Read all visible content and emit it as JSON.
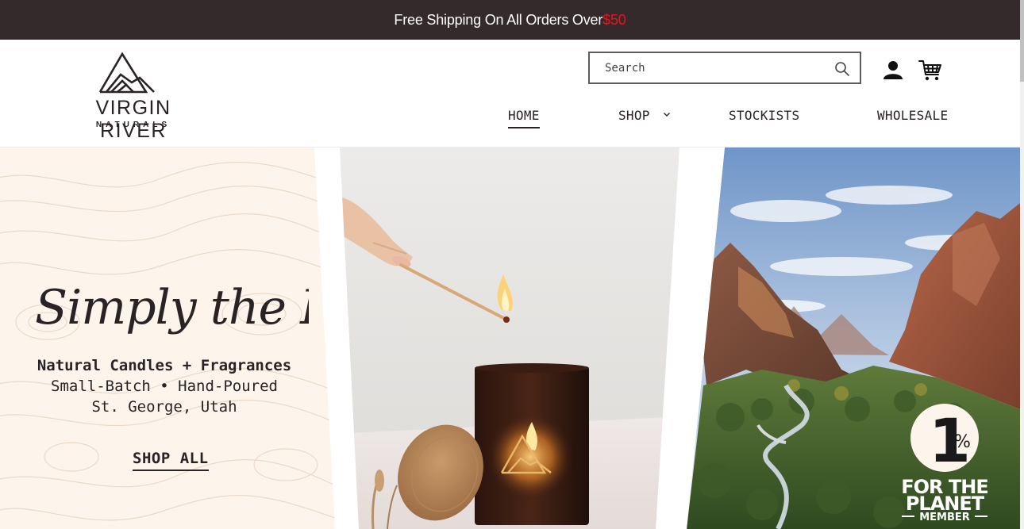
{
  "announcement": {
    "text": "Free Shipping On All Orders Over ",
    "amount": "$50"
  },
  "brand": {
    "name": "VIRGIN RIVER",
    "sub": "NATURALS"
  },
  "search": {
    "placeholder": "Search"
  },
  "nav": {
    "items": [
      {
        "label": "HOME",
        "active": true
      },
      {
        "label": "SHOP",
        "has_dropdown": true
      },
      {
        "label": "STOCKISTS"
      },
      {
        "label": "WHOLESALE"
      }
    ]
  },
  "hero": {
    "script_title": "Simply the Best",
    "tagline_1": "Natural Candles + Fragrances",
    "tagline_2": "Small-Batch • Hand-Poured",
    "tagline_3": "St. George, Utah",
    "cta": "SHOP ALL",
    "badge_line1": "1",
    "badge_pct": "%",
    "badge_line2": "FOR THE",
    "badge_line3": "PLANET",
    "badge_line4": "MEMBER"
  },
  "colors": {
    "announcement_bg": "#342a2b",
    "accent_red": "#e8131c",
    "hero_cream": "#fdf5ec",
    "text_dark": "#2a2325"
  },
  "icons": [
    "search-icon",
    "account-icon",
    "cart-icon",
    "chevron-down-icon",
    "mountain-logo-icon"
  ]
}
